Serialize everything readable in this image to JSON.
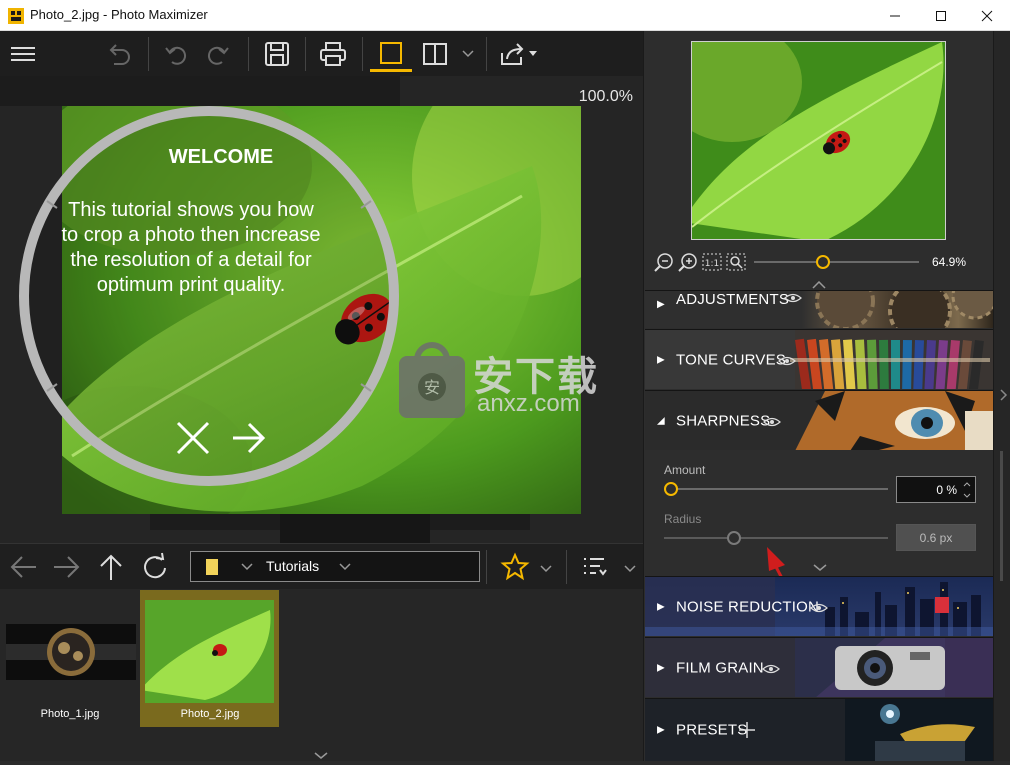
{
  "window": {
    "title": "Photo_2.jpg - Photo Maximizer",
    "minimize": "—",
    "maximize": "☐",
    "close": "✕"
  },
  "canvas": {
    "zoom": "100.0%"
  },
  "tutorial": {
    "heading": "WELCOME",
    "line1": "This tutorial shows you how",
    "line2": "to crop a photo then increase",
    "line3": "the resolution of a detail for",
    "line4": "optimum print quality."
  },
  "watermark": {
    "chinese": "安下载",
    "domain": "anxz.com"
  },
  "navigator": {
    "zoom_percent": "64.9%",
    "zoom_slider_fraction": 0.41
  },
  "browser": {
    "folder": "Tutorials",
    "thumbnails": [
      {
        "name": "Photo_1.jpg",
        "selected": false
      },
      {
        "name": "Photo_2.jpg",
        "selected": true
      }
    ]
  },
  "panels": {
    "adjustments": "ADJUSTMENTS",
    "tone_curves": "TONE CURVES",
    "sharpness": "SHARPNESS",
    "noise_reduction": "NOISE REDUCTION",
    "film_grain": "FILM GRAIN",
    "presets": "PRESETS"
  },
  "sharpness": {
    "amount_label": "Amount",
    "amount_value": "0 %",
    "amount_fraction": 0.0,
    "radius_label": "Radius",
    "radius_value": "0.6 px",
    "radius_fraction": 0.3
  },
  "colors": {
    "accent": "#f5b800",
    "selected_thumb_bg": "#7a6a1e"
  }
}
